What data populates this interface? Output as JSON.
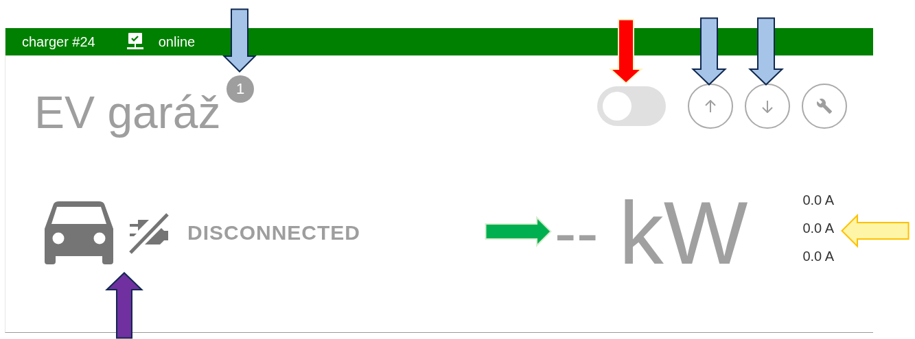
{
  "header": {
    "charger": "charger #24",
    "status": "online"
  },
  "title": "EV garáž",
  "badge": "1",
  "toggle": {
    "on": false
  },
  "buttons": [
    {
      "kind": "up"
    },
    {
      "kind": "down"
    },
    {
      "kind": "wrench"
    }
  ],
  "vehicle": {
    "connected": false,
    "status": "DISCONNECTED"
  },
  "power": {
    "value": "--",
    "unit": "kW"
  },
  "currents": [
    "0.0 A",
    "0.0 A",
    "0.0 A"
  ],
  "annotations": [
    {
      "color": "#a6c4e8"
    },
    {
      "color": "#ff0000"
    },
    {
      "color": "#a6c4e8"
    },
    {
      "color": "#a6c4e8"
    },
    {
      "color": "#7030a0"
    },
    {
      "color": "#00b050"
    },
    {
      "color": "#fff5a6"
    }
  ]
}
